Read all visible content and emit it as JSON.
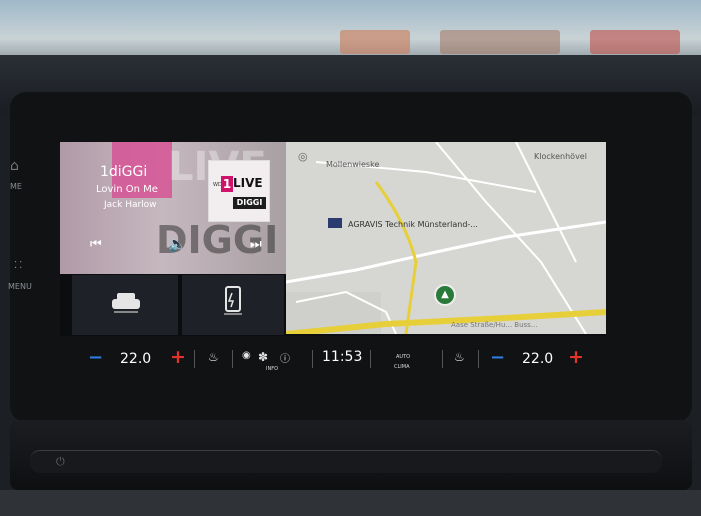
{
  "left_rail": {
    "home_label": "ME",
    "menu_label": "MENU"
  },
  "media": {
    "bg_word_top": "LIVE",
    "bg_word_bottom": "DIGGI",
    "station": "1diGGi",
    "song": "Lovin On Me",
    "artist": "Jack Harlow",
    "logo": {
      "wdr": "WDR",
      "one": "1",
      "live": "LIVE",
      "diggi": "DIGGI"
    },
    "prev_icon": "skip-back-icon",
    "volume_icon": "speaker-icon",
    "next_icon": "skip-forward-icon"
  },
  "quick_buttons": [
    {
      "icon": "car-icon"
    },
    {
      "icon": "phone-charging-icon"
    }
  ],
  "map": {
    "place_top": "Mollenwieske",
    "place_top_right": "Klockenhövel",
    "poi": "AGRAVIS Technik Münsterland-...",
    "bottom_road": "Aase Straße/Hu... Buss..."
  },
  "hvac": {
    "left_temp": "22.0",
    "right_temp": "22.0",
    "minus": "−",
    "plus": "+",
    "time": "11:53",
    "info_label": "INFO",
    "auto_label": "AUTO",
    "clima_label": "CLIMA"
  },
  "colors": {
    "minus": "#2f7de0",
    "plus": "#e0332a",
    "route": "#e7cf3a",
    "accent": "#d74d94"
  }
}
